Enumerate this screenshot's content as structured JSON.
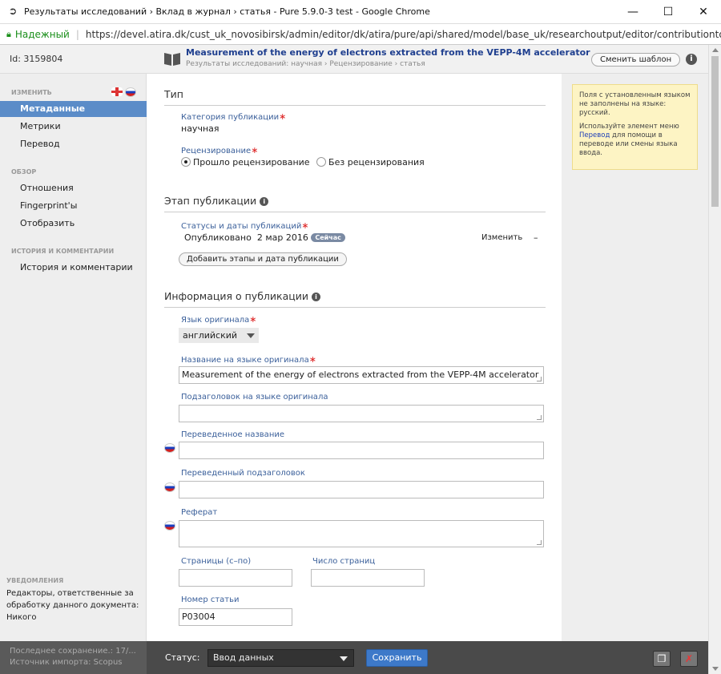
{
  "window": {
    "title": "Результаты исследований › Вклад в журнал › статья - Pure 5.9.0-3 test - Google Chrome",
    "minimize": "—",
    "maximize": "☐",
    "close": "✕"
  },
  "address": {
    "secure_label": "Надежный",
    "url": "https://devel.atira.dk/cust_uk_novosibirsk/admin/editor/dk/atira/pure/api/shared/model/base_uk/researchoutput/editor/contributiontojourn"
  },
  "header": {
    "id": "Id: 3159804",
    "title": "Measurement of the energy of electrons extracted from the VEPP-4M accelerator",
    "subtitle": "Результаты исследований: научная › Рецензирование › статья",
    "template_button": "Сменить шаблон",
    "info": "i"
  },
  "sidebar": {
    "edit_heading": "ИЗМЕНИТЬ",
    "edit_items": [
      {
        "label": "Метаданные"
      },
      {
        "label": "Метрики"
      },
      {
        "label": "Перевод"
      }
    ],
    "overview_heading": "ОБЗОР",
    "overview_items": [
      {
        "label": "Отношения"
      },
      {
        "label": "Fingerprint'ы"
      },
      {
        "label": "Отобразить"
      }
    ],
    "history_heading": "ИСТОРИЯ И КОММЕНТАРИИ",
    "history_items": [
      {
        "label": "История и комментарии"
      }
    ],
    "notifications_heading": "УВЕДОМЛЕНИЯ",
    "notifications_text": "Редакторы, ответственные за обработку данного документа: Никого"
  },
  "form": {
    "type_section": "Тип",
    "category_label": "Категория публикации",
    "category_value": "научная",
    "review_label": "Рецензирование",
    "review_option_yes": "Прошло рецензирование",
    "review_option_no": "Без рецензирования",
    "stage_section": "Этап публикации",
    "status_label": "Статусы и даты публикаций",
    "status_value": "Опубликовано",
    "status_date": "2 мар 2016",
    "status_badge": "Сейчас",
    "edit_link": "Изменить",
    "remove": "–",
    "add_stage_button": "Добавить этапы и дата публикации",
    "info_section": "Информация о публикации",
    "lang_label": "Язык оригинала",
    "lang_value": "английский",
    "orig_title_label": "Название на языке оригинала",
    "orig_title_value": "Measurement of the energy of electrons extracted from the VEPP-4M accelerator",
    "orig_subtitle_label": "Подзаголовок на языке оригинала",
    "trans_title_label": "Переведенное название",
    "trans_subtitle_label": "Переведенный подзаголовок",
    "abstract_label": "Реферат",
    "pages_label": "Страницы (с–по)",
    "page_count_label": "Число страниц",
    "article_no_label": "Номер статьи",
    "article_no_value": "P03004",
    "required_mark": "∗",
    "info_icon": "i"
  },
  "notice": {
    "line1": "Поля с установленным языком не заполнены на языке: русский.",
    "pre": "Используйте элемент меню ",
    "link": "Перевод",
    "post": " для помощи в переводе или смены языка ввода."
  },
  "footer": {
    "last_save": "Последнее сохранение.: 17/...",
    "import_source": "Источник импорта: Scopus",
    "status_label": "Статус:",
    "status_value": "Ввод данных",
    "save": "Сохранить",
    "copy_icon": "❐",
    "delete_icon": "✗"
  }
}
